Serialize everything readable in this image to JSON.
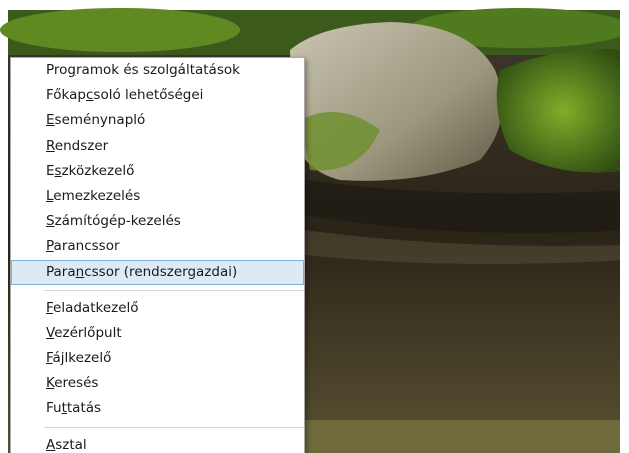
{
  "context_menu": {
    "groups": [
      {
        "items": [
          {
            "label": "Programok és szolgáltatások",
            "access_key_index": 3
          },
          {
            "label": "Főkapcsoló lehetőségei",
            "access_key_index": 5
          },
          {
            "label": "Eseménynapló",
            "access_key_index": 0
          },
          {
            "label": "Rendszer",
            "access_key_index": 0
          },
          {
            "label": "Eszközkezelő",
            "access_key_index": 1
          },
          {
            "label": "Lemezkezelés",
            "access_key_index": 0
          },
          {
            "label": "Számítógép-kezelés",
            "access_key_index": 0
          },
          {
            "label": "Parancssor",
            "access_key_index": 0
          },
          {
            "label": "Parancssor (rendszergazdai)",
            "access_key_index": 4,
            "highlighted": true
          }
        ]
      },
      {
        "items": [
          {
            "label": "Feladatkezelő",
            "access_key_index": 0
          },
          {
            "label": "Vezérlőpult",
            "access_key_index": 0
          },
          {
            "label": "Fájlkezelő",
            "access_key_index": 0
          },
          {
            "label": "Keresés",
            "access_key_index": 0
          },
          {
            "label": "Futtatás",
            "access_key_index": 2
          }
        ]
      },
      {
        "items": [
          {
            "label": "Asztal",
            "access_key_index": 0
          }
        ]
      }
    ]
  },
  "colors": {
    "highlight_fill": "#dceaf6",
    "highlight_border": "#7fb0d8",
    "menu_background": "#ffffff"
  }
}
